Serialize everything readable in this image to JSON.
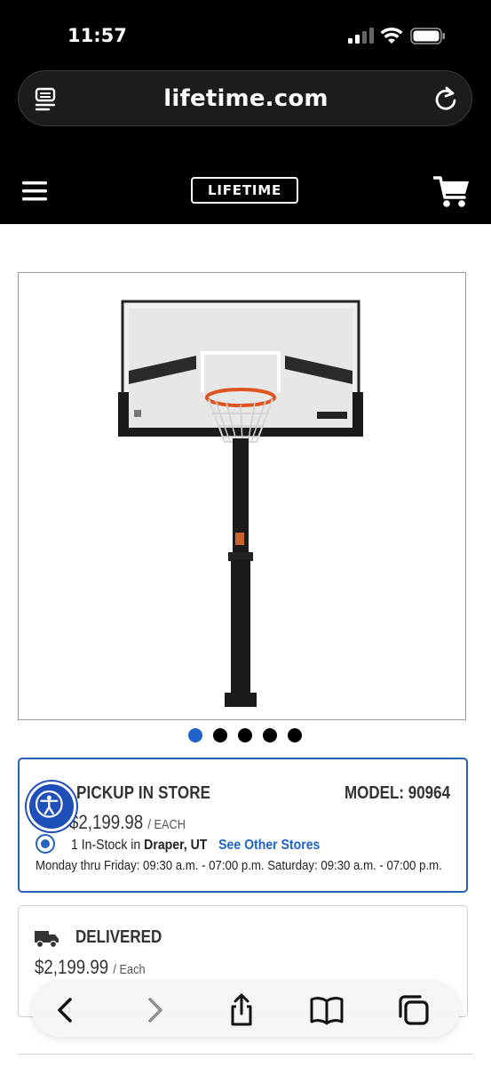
{
  "status_bar": {
    "time": "11:57"
  },
  "browser": {
    "url": "lifetime.com"
  },
  "header": {
    "logo_text": "LIFETIME"
  },
  "gallery": {
    "dot_count": 5,
    "active_index": 0
  },
  "pickup": {
    "title": "PICKUP IN STORE",
    "model": "MODEL: 90964",
    "price": "$2,199.98",
    "price_unit": "/ EACH",
    "stock_count": "1 In-Stock in",
    "store": "Draper, UT",
    "see_stores": "See Other Stores",
    "hours": "Monday thru Friday: 09:30 a.m. - 07:00 p.m. Saturday: 09:30 a.m. - 07:00 p.m."
  },
  "delivery": {
    "title": "DELIVERED",
    "price": "$2,199.99",
    "price_unit": "/ Each"
  },
  "colors": {
    "accent": "#1f63c8",
    "topbar": "#000000"
  }
}
